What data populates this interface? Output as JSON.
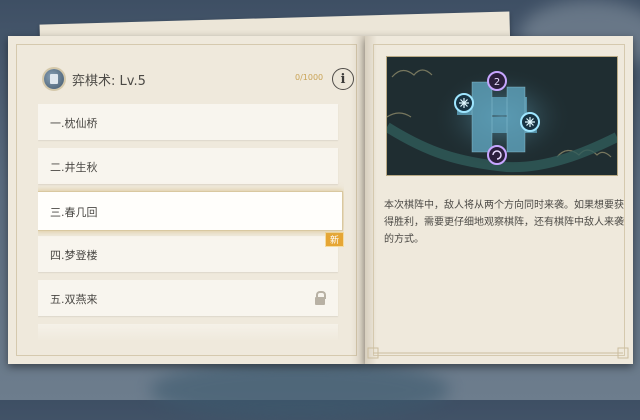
{
  "header": {
    "title": "弈棋术: Lv.5",
    "xp_text": "0/1000",
    "info_label": "i",
    "book_icon": "book-icon"
  },
  "stages": [
    {
      "label": "一.枕仙桥",
      "state": "normal"
    },
    {
      "label": "二.井生秋",
      "state": "normal"
    },
    {
      "label": "三.春几回",
      "state": "selected"
    },
    {
      "label": "四.梦登楼",
      "state": "new"
    },
    {
      "label": "五.双燕来",
      "state": "locked"
    }
  ],
  "badges": {
    "new_label": "新"
  },
  "description": "本次棋阵中，敌人将从两个方向同时来袭。如果想要获得胜利，需要更仔细地观察棋阵，还有棋阵中敌人来袭的方式。",
  "preview": {
    "markers": [
      {
        "icon": "swirl-portal-icon",
        "color": "#c7a6ff",
        "number": "2"
      },
      {
        "icon": "snowflake-portal-icon",
        "color": "#9fe6ff"
      },
      {
        "icon": "snowflake-portal-icon",
        "color": "#9fe6ff"
      },
      {
        "icon": "swirl-portal-icon",
        "color": "#c7a6ff"
      }
    ]
  },
  "colors": {
    "paper": "#efe9dc",
    "accent_gold": "#c9a356",
    "new_badge": "#e6a634",
    "text": "#4c4a46"
  }
}
